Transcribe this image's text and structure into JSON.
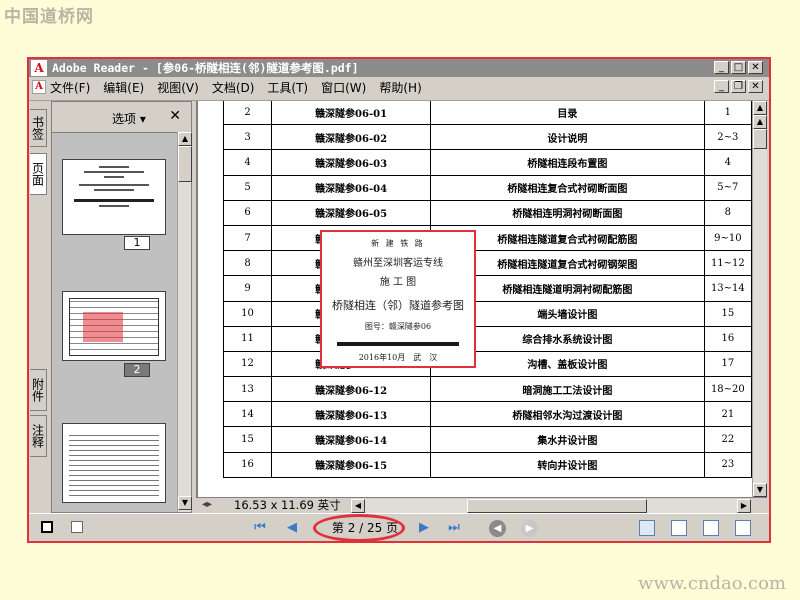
{
  "watermarks": {
    "top_left": "中国道桥网",
    "bottom_right": "www.cndao.com"
  },
  "window": {
    "title": "Adobe Reader - [参06-桥隧相连(邻)隧道参考图.pdf]",
    "logo_glyph": "A"
  },
  "menu": {
    "items": [
      "文件(F)",
      "编辑(E)",
      "视图(V)",
      "文档(D)",
      "工具(T)",
      "窗口(W)",
      "帮助(H)"
    ]
  },
  "left_tabs": {
    "bookmarks": "书签",
    "pages": "页面",
    "attachments": "附件",
    "comments": "注释"
  },
  "nav_panel": {
    "options_label": "选项 ▾",
    "close_glyph": "✕",
    "thumbnails": [
      {
        "number": "1",
        "selected": false
      },
      {
        "number": "2",
        "selected": true
      }
    ]
  },
  "document": {
    "rows": [
      {
        "no": "2",
        "code": "赣深隧参06-01",
        "title": "目录",
        "pages": "1"
      },
      {
        "no": "3",
        "code": "赣深隧参06-02",
        "title": "设计说明",
        "pages": "2~3"
      },
      {
        "no": "4",
        "code": "赣深隧参06-03",
        "title": "桥隧相连段布置图",
        "pages": "4"
      },
      {
        "no": "5",
        "code": "赣深隧参06-04",
        "title": "桥隧相连复合式衬砌断面图",
        "pages": "5~7"
      },
      {
        "no": "6",
        "code": "赣深隧参06-05",
        "title": "桥隧相连明洞衬砌断面图",
        "pages": "8"
      },
      {
        "no": "7",
        "code": "赣深隧参06-06",
        "title": "桥隧相连隧道复合式衬砌配筋图",
        "pages": "9~10"
      },
      {
        "no": "8",
        "code": "赣深隧参06-07",
        "title": "桥隧相连隧道复合式衬砌钢架图",
        "pages": "11~12"
      },
      {
        "no": "9",
        "code": "赣深隧参06-08",
        "title": "桥隧相连隧道明洞衬砌配筋图",
        "pages": "13~14"
      },
      {
        "no": "10",
        "code": "赣深隧参06-09",
        "title": "端头墙设计图",
        "pages": "15"
      },
      {
        "no": "11",
        "code": "赣深隧参06-10",
        "title": "综合排水系统设计图",
        "pages": "16"
      },
      {
        "no": "12",
        "code": "赣深隧参06-11",
        "title": "沟槽、盖板设计图",
        "pages": "17"
      },
      {
        "no": "13",
        "code": "赣深隧参06-12",
        "title": "暗洞施工工法设计图",
        "pages": "18~20"
      },
      {
        "no": "14",
        "code": "赣深隧参06-13",
        "title": "桥隧相邻水沟过渡设计图",
        "pages": "21"
      },
      {
        "no": "15",
        "code": "赣深隧参06-14",
        "title": "集水井设计图",
        "pages": "22"
      },
      {
        "no": "16",
        "code": "赣深隧参06-15",
        "title": "转向井设计图",
        "pages": "23"
      }
    ]
  },
  "cover_popup": {
    "line1": "新 建 铁 路",
    "line2": "赣州至深圳客运专线",
    "line3": "施 工 图",
    "line4": "桥隧相连（邻）隧道参考图",
    "line5": "图号：赣深隧参06",
    "line7": "2016年10月　武　汉"
  },
  "bottom_bar": {
    "page_size": "16.53 x 11.69 英寸"
  },
  "status_bar": {
    "page_indicator": "第 2 / 25 页"
  }
}
